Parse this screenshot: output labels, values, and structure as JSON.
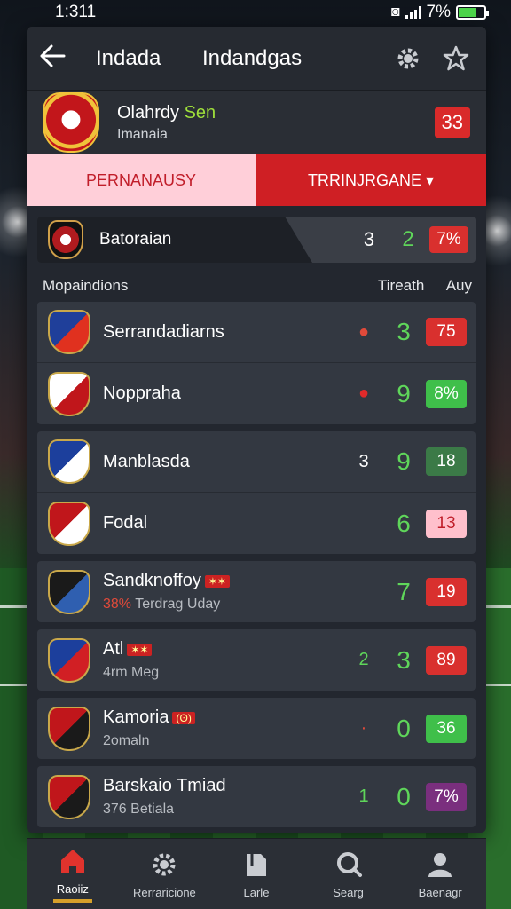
{
  "status": {
    "time": "1:311",
    "battery": "7%"
  },
  "topbar": {
    "title1": "Indada",
    "title2": "Indandgas"
  },
  "team": {
    "name": "Olahrdy ",
    "name_accent": "Sen",
    "subtitle": "Imanaia",
    "badge": "33"
  },
  "tabs": {
    "left": "PERNANAUSY",
    "right": "TRRINJRGANE ▾"
  },
  "hero": {
    "label": "Batoraian",
    "val1": "3",
    "val2": "2",
    "pill": "7%"
  },
  "columns": {
    "c1": "Mopaindions",
    "c2": "Tireath",
    "c3": "Auy"
  },
  "groups": [
    {
      "rows": [
        {
          "name": "Serrandadiarns",
          "sub": "",
          "ev": "●",
          "ev_color": "#e04a3a",
          "score": "3",
          "pill": "75",
          "pill_bg": "#d9302e",
          "pill_fg": "#ffffff",
          "crest": [
            "#1f3f9a",
            "#e0311f"
          ]
        },
        {
          "name": "Noppraha",
          "sub": "",
          "ev": "●",
          "ev_color": "#e02a2a",
          "score": "9",
          "pill": "8%",
          "pill_bg": "#3fbf4a",
          "pill_fg": "#ffffff",
          "crest": [
            "#ffffff",
            "#c0161b"
          ]
        }
      ]
    },
    {
      "rows": [
        {
          "name": "Manblasda",
          "sub": "",
          "ev": "3",
          "ev_color": "#ffffff",
          "score": "9",
          "pill": "18",
          "pill_bg": "#3b7a47",
          "pill_fg": "#ffffff",
          "crest": [
            "#1c3f9c",
            "#ffffff"
          ]
        },
        {
          "name": "Fodal",
          "sub": "",
          "ev": "",
          "ev_color": "#ffffff",
          "score": "6",
          "pill": "13",
          "pill_bg": "#ffc0cc",
          "pill_fg": "#c01e2a",
          "crest": [
            "#c0161b",
            "#ffffff"
          ]
        }
      ]
    },
    {
      "rows": [
        {
          "name": "Sandknoffoy",
          "flag": "✶✶",
          "sub_red": "38%",
          "sub": " Terdrag Uday",
          "ev": "",
          "ev_color": "#ffffff",
          "score": "7",
          "pill": "19",
          "pill_bg": "#d9302e",
          "pill_fg": "#ffffff",
          "crest": [
            "#1a1a1a",
            "#2f5fb0"
          ]
        }
      ]
    },
    {
      "rows": [
        {
          "name": "Atl",
          "flag": "✶✶",
          "sub": "4rm Meg",
          "ev": "2",
          "ev_color": "#5fd65a",
          "score": "3",
          "pill": "89",
          "pill_bg": "#d9302e",
          "pill_fg": "#ffffff",
          "crest": [
            "#1c3f9c",
            "#d11f24"
          ]
        }
      ]
    },
    {
      "rows": [
        {
          "name": "Kamoria",
          "flag": "(ʘ)",
          "sub": "2omaln",
          "ev": "·",
          "ev_color": "#e04a3a",
          "score": "0",
          "pill": "36",
          "pill_bg": "#3fbf4a",
          "pill_fg": "#ffffff",
          "crest": [
            "#c0161b",
            "#1a1a1a"
          ]
        }
      ]
    },
    {
      "rows": [
        {
          "name": "Barskaio Tmiad",
          "sub": "376 Betiala",
          "ev": "1",
          "ev_color": "#5fd65a",
          "score": "0",
          "pill": "7%",
          "pill_bg": "#7a2f7e",
          "pill_fg": "#ffffff",
          "crest": [
            "#c0161b",
            "#1a1a1a"
          ]
        }
      ]
    }
  ],
  "nav": [
    {
      "label": "Raoiiz",
      "icon": "home-icon",
      "active": true
    },
    {
      "label": "Rerraricione",
      "icon": "gear-icon",
      "active": false
    },
    {
      "label": "Larle",
      "icon": "book-icon",
      "active": false
    },
    {
      "label": "Searg",
      "icon": "search-icon",
      "active": false
    },
    {
      "label": "Baenagr",
      "icon": "person-icon",
      "active": false
    }
  ]
}
